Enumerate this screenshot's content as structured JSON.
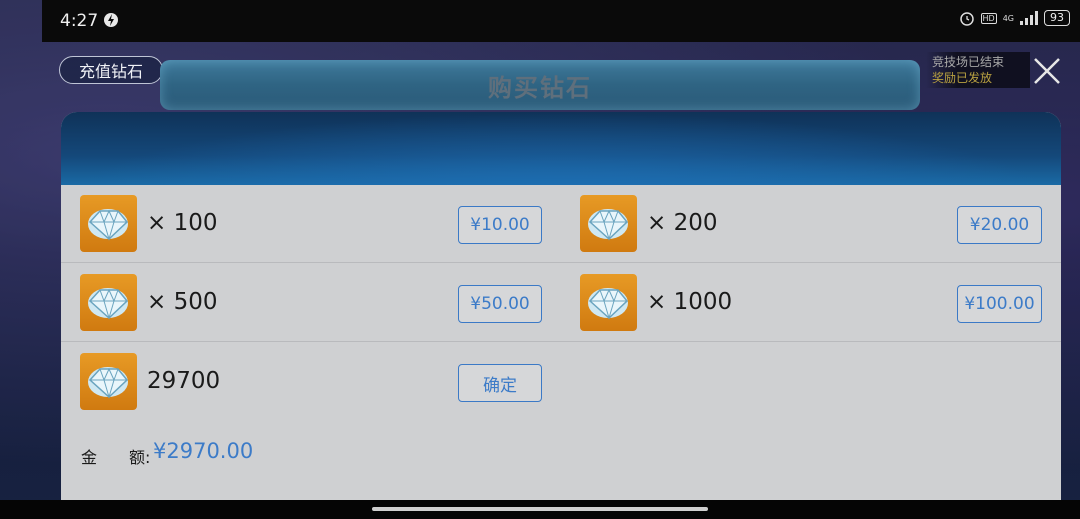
{
  "status_bar": {
    "time": "4:27",
    "network": "4G",
    "hd": "HD",
    "battery": "93"
  },
  "top": {
    "recharge_label": "充值钻石",
    "title": "购买钻石",
    "notice_line1": "竞技场已结束",
    "notice_line2": "奖励已发放"
  },
  "packages": [
    {
      "quantity": "× 100",
      "price": "¥10.00"
    },
    {
      "quantity": "× 200",
      "price": "¥20.00"
    },
    {
      "quantity": "× 500",
      "price": "¥50.00"
    },
    {
      "quantity": "× 1000",
      "price": "¥100.00"
    }
  ],
  "custom": {
    "value": "29700",
    "confirm_label": "确定"
  },
  "amount": {
    "label": "金　　额:",
    "value": "¥2970.00"
  },
  "colors": {
    "accent": "#3c7bc8",
    "panel": "#cfd0d2",
    "gem_bg": "#e08a1c"
  }
}
